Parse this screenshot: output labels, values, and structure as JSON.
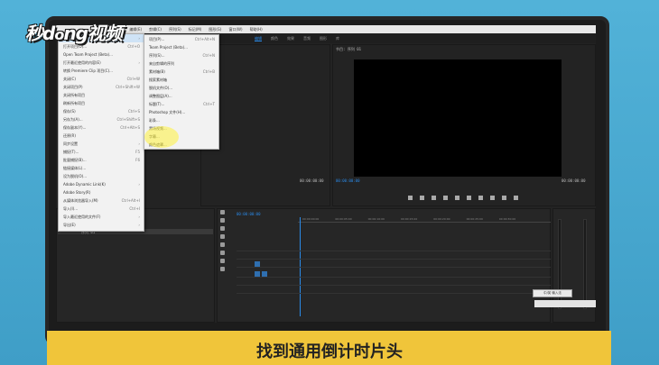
{
  "watermark": {
    "text": "秒懂视频"
  },
  "menubar": {
    "items": [
      "文件(F)",
      "编辑(E)",
      "剪辑(C)",
      "序列(S)",
      "标记(M)",
      "图形(G)",
      "窗口(W)",
      "帮助(H)"
    ]
  },
  "workspace": {
    "items": [
      "编辑",
      "颜色",
      "效果",
      "音频",
      "图形",
      "库"
    ],
    "active_index": 0
  },
  "file_menu": {
    "items": [
      {
        "label": "新建(N)",
        "short": "",
        "has_sub": true,
        "hl": true
      },
      {
        "label": "打开项目(O)...",
        "short": "Ctrl+O"
      },
      {
        "label": "Open Team Project (Beta)...",
        "short": ""
      },
      {
        "label": "打开最近使用的内容(E)",
        "short": "",
        "has_sub": true
      },
      {
        "label": "转换 Premiere Clip 项目(C)...",
        "short": ""
      },
      {
        "label": "关闭(C)",
        "short": "Ctrl+W"
      },
      {
        "label": "关闭项目(P)",
        "short": "Ctrl+Shift+W"
      },
      {
        "label": "关闭所有项目",
        "short": ""
      },
      {
        "label": "刷新所有项目",
        "short": ""
      },
      {
        "label": "保存(S)",
        "short": "Ctrl+S"
      },
      {
        "label": "另存为(A)...",
        "short": "Ctrl+Shift+S"
      },
      {
        "label": "保存副本(Y)...",
        "short": "Ctrl+Alt+S"
      },
      {
        "label": "还原(R)",
        "short": ""
      },
      {
        "label": "同步设置",
        "short": "",
        "has_sub": true
      },
      {
        "label": "捕捉(T)...",
        "short": "F5"
      },
      {
        "label": "批量捕捉(B)...",
        "short": "F6"
      },
      {
        "label": "链接媒体(L)...",
        "short": ""
      },
      {
        "label": "设为脱机(O)...",
        "short": ""
      },
      {
        "label": "Adobe Dynamic Link(K)",
        "short": "",
        "has_sub": true
      },
      {
        "label": "Adobe Story(R)",
        "short": ""
      },
      {
        "label": "从媒体浏览器导入(M)",
        "short": "Ctrl+Alt+I"
      },
      {
        "label": "导入(I)...",
        "short": "Ctrl+I"
      },
      {
        "label": "导入最近使用的文件(F)",
        "short": "",
        "has_sub": true
      },
      {
        "label": "导出(E)",
        "short": "",
        "has_sub": true
      },
      {
        "label": "获取属性(G)",
        "short": "",
        "has_sub": true
      },
      {
        "label": "项目设置(P)",
        "short": "",
        "has_sub": true
      },
      {
        "label": "项目管理(M)...",
        "short": ""
      },
      {
        "label": "退出(X)",
        "short": "Ctrl+Q"
      }
    ]
  },
  "new_submenu": {
    "items": [
      {
        "label": "项目(P)...",
        "short": "Ctrl+Alt+N"
      },
      {
        "label": "Team Project (Beta)...",
        "short": ""
      },
      {
        "label": "序列(S)...",
        "short": "Ctrl+N"
      },
      {
        "label": "来自剪辑的序列",
        "short": ""
      },
      {
        "label": "素材箱(B)",
        "short": "Ctrl+B"
      },
      {
        "label": "搜索素材箱",
        "short": ""
      },
      {
        "label": "脱机文件(O)...",
        "short": ""
      },
      {
        "label": "调整图层(A)...",
        "short": ""
      },
      {
        "label": "标题(T)...",
        "short": "Ctrl+T"
      },
      {
        "label": "Photoshop 文件(H)...",
        "short": ""
      },
      {
        "label": "彩条...",
        "short": ""
      },
      {
        "label": "黑场视频...",
        "short": ""
      },
      {
        "label": "字幕...",
        "short": ""
      },
      {
        "label": "颜色遮罩...",
        "short": ""
      },
      {
        "label": "HD 彩条...",
        "short": ""
      },
      {
        "label": "通用倒计时片头...",
        "short": "",
        "hl": true
      },
      {
        "label": "透明视频...",
        "short": ""
      }
    ]
  },
  "source_monitor": {
    "timecode": "00:00:00:00"
  },
  "program_monitor": {
    "timecode_left": "00:00:00:00",
    "timecode_right": "00:00:00:00",
    "label": "节目: 序列 01"
  },
  "timeline": {
    "timecode": "00:00:00:00",
    "ruler": [
      "00:00:00:00",
      "00:00:05:00",
      "00:00:10:00",
      "00:00:15:00",
      "00:00:20:00",
      "00:00:25:00",
      "00:00:30:00",
      "00:00:35:00",
      "00:00:40:00"
    ]
  },
  "project": {
    "clip_name": "序列 01"
  },
  "tooltip": {
    "text": "中/英 输入法"
  },
  "caption": {
    "text": "找到通用倒计时片头"
  }
}
